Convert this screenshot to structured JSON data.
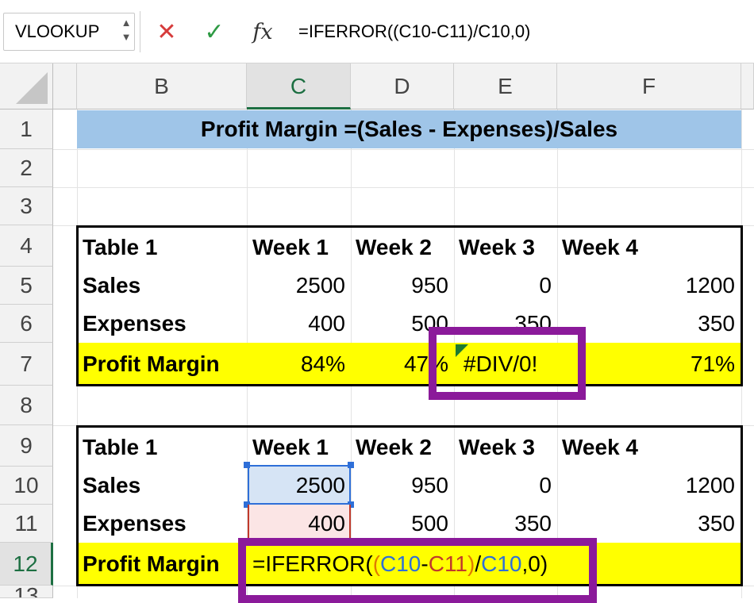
{
  "formula_bar": {
    "name_box": "VLOOKUP",
    "cancel_icon": "✕",
    "enter_icon": "✓",
    "fx_label": "fx",
    "formula": "=IFERROR((C10-C11)/C10,0)"
  },
  "columns": [
    "B",
    "C",
    "D",
    "E",
    "F"
  ],
  "rows": [
    "1",
    "2",
    "3",
    "4",
    "5",
    "6",
    "7",
    "8",
    "9",
    "10",
    "11",
    "12",
    "13"
  ],
  "title": "Profit Margin =(Sales - Expenses)/Sales",
  "table1": {
    "headers": [
      "Table 1",
      "Week 1",
      "Week 2",
      "Week 3",
      "Week 4"
    ],
    "sales": [
      "Sales",
      "2500",
      "950",
      "0",
      "1200"
    ],
    "expenses": [
      "Expenses",
      "400",
      "500",
      "350",
      "350"
    ],
    "margin": [
      "Profit Margin",
      "84%",
      "47%",
      "#DIV/0!",
      "71%"
    ]
  },
  "table2": {
    "headers": [
      "Table 1",
      "Week 1",
      "Week 2",
      "Week 3",
      "Week 4"
    ],
    "sales": [
      "Sales",
      "2500",
      "950",
      "0",
      "1200"
    ],
    "expenses": [
      "Expenses",
      "400",
      "500",
      "350",
      "350"
    ],
    "margin_label": "Profit Margin",
    "edit_formula": {
      "p1": "=IFERROR(",
      "p2": "(",
      "p3": "C10",
      "p4": "-",
      "p5": "C11",
      "p6": ")",
      "p7": "/",
      "p8": "C10",
      "p9": ",0)"
    }
  },
  "colors": {
    "title_fill": "#9fc5e8",
    "highlight_fill": "#ffff00",
    "annotation_box": "#8b1a9a",
    "ref_blue": "#2e6fd8",
    "ref_red": "#c0392b",
    "selected_header": "#1d6f42"
  }
}
